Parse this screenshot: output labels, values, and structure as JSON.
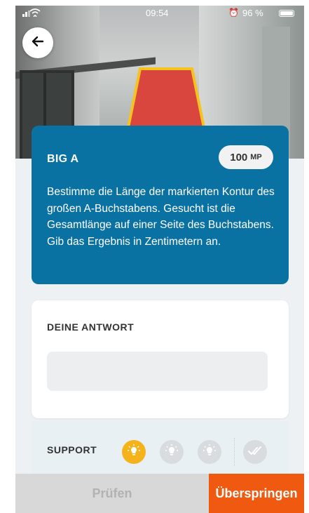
{
  "status_bar": {
    "time": "09:54",
    "battery_percent": "96 %",
    "alarm_glyph": "⏰"
  },
  "header": {
    "back_icon": "arrow-left-icon"
  },
  "task": {
    "title": "BIG A",
    "points_value": "100",
    "points_unit": "MP",
    "description": "Bestimme die Länge der markierten Kontur des großen A-Buchstabens. Gesucht ist die Gesamtlänge auf einer Seite des Buchstabens. Gib das Ergebnis in Zentimetern an."
  },
  "answer": {
    "label": "DEINE ANTWORT",
    "value": "",
    "placeholder": ""
  },
  "support": {
    "label": "SUPPORT",
    "hints": [
      {
        "icon": "lightbulb-icon",
        "state": "active"
      },
      {
        "icon": "lightbulb-icon",
        "state": "inactive"
      },
      {
        "icon": "lightbulb-icon",
        "state": "inactive"
      }
    ],
    "solution_icon": "double-check-icon"
  },
  "actions": {
    "check_label": "Prüfen",
    "skip_label": "Überspringen"
  },
  "colors": {
    "task_card": "#0a71a3",
    "hint_active": "#f5b31b",
    "skip_button": "#f05a10",
    "check_button_disabled": "#d8d8d8"
  }
}
